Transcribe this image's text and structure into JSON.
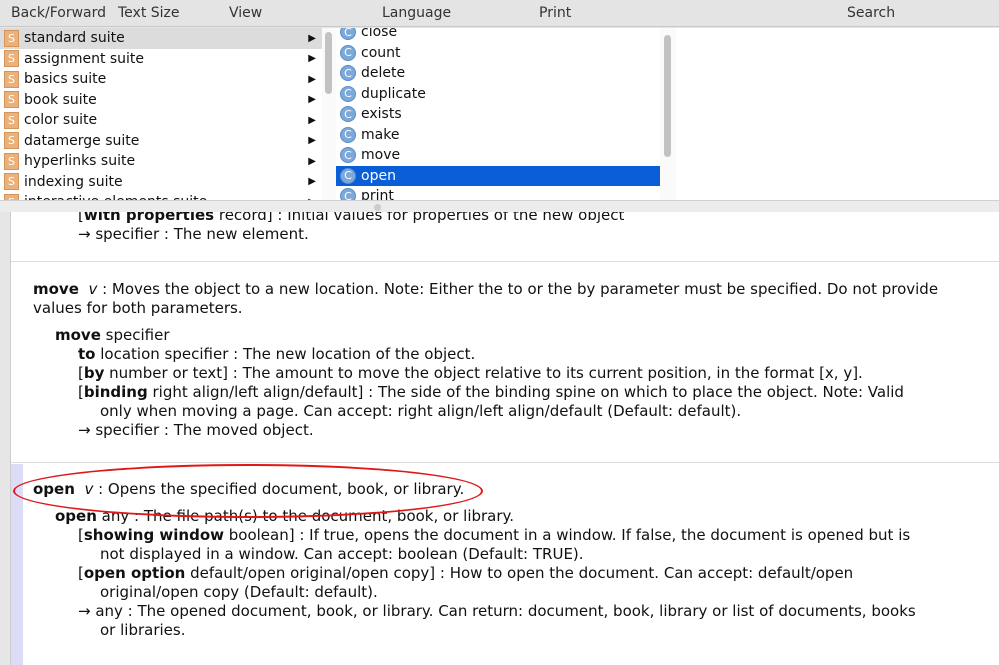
{
  "toolbar": {
    "back_forward": "Back/Forward",
    "text_size": "Text Size",
    "view": "View",
    "language": "Language",
    "print": "Print",
    "search": "Search"
  },
  "suites": [
    {
      "label": "standard suite",
      "icon": "S"
    },
    {
      "label": "assignment suite",
      "icon": "S"
    },
    {
      "label": "basics suite",
      "icon": "S"
    },
    {
      "label": "book suite",
      "icon": "S"
    },
    {
      "label": "color suite",
      "icon": "S"
    },
    {
      "label": "datamerge suite",
      "icon": "S"
    },
    {
      "label": "hyperlinks suite",
      "icon": "S"
    },
    {
      "label": "indexing suite",
      "icon": "S"
    },
    {
      "label": "interactive elements suite",
      "icon": "S"
    }
  ],
  "commands": [
    {
      "label": "close",
      "icon": "C"
    },
    {
      "label": "count",
      "icon": "C"
    },
    {
      "label": "delete",
      "icon": "C"
    },
    {
      "label": "duplicate",
      "icon": "C"
    },
    {
      "label": "exists",
      "icon": "C"
    },
    {
      "label": "make",
      "icon": "C"
    },
    {
      "label": "move",
      "icon": "C"
    },
    {
      "label": "open",
      "icon": "C"
    },
    {
      "label": "print",
      "icon": "C"
    }
  ],
  "selected_suite": "standard suite",
  "selected_command": "open",
  "doc": {
    "make_tail": {
      "param_name": "with properties",
      "param_type": " record] : Initial values for properties of the new object",
      "ret": "→ specifier : The new element."
    },
    "move": {
      "name": "move",
      "kind": "v",
      "desc": " : Moves the object to a new location. Note: Either the to or the by parameter must be specified. Do not provide",
      "desc2": "values for both parameters.",
      "direct_name": "move",
      "direct_type": " specifier",
      "p1_name": "to",
      "p1_rest": " location specifier : The new location of the object.",
      "p2_name": "by",
      "p2_rest": " number or text] : The amount to move the object relative to its current position, in the format [x, y].",
      "p3_name": "binding",
      "p3_rest": " right align/left align/default] : The side of the binding spine on which to place the object. Note: Valid",
      "p3_cont": "only when moving a page. Can accept: right align/left align/default (Default: default).",
      "ret": "→ specifier : The moved object."
    },
    "open": {
      "name": "open",
      "kind": "v",
      "desc": " : Opens the specified document, book, or library.",
      "direct_name": "open",
      "direct_rest": " any : The file path(s) to the document, book, or library.",
      "p1_name": "showing window",
      "p1_rest": " boolean] : If true, opens the document in a window. If false, the document is opened but is",
      "p1_cont": "not displayed in a window. Can accept: boolean (Default: TRUE).",
      "p2_name": "open option",
      "p2_rest": " default/open original/open copy] : How to open the document. Can accept: default/open",
      "p2_cont": "original/open copy (Default: default).",
      "ret": "→ any : The opened document, book, or library. Can return: document, book, library or list of documents, books",
      "ret_cont": "or libraries."
    }
  },
  "colors": {
    "selection": "#0a5fd8",
    "annotation": "#e01818",
    "suite_icon": "#eab27a",
    "command_icon": "#7da9da"
  }
}
